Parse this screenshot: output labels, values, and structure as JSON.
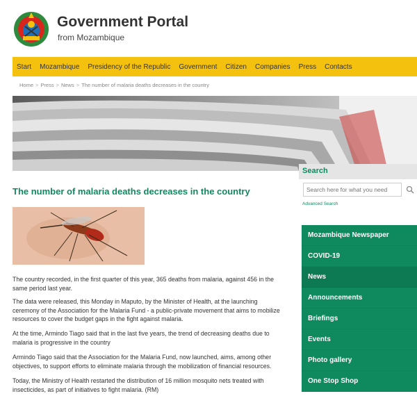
{
  "header": {
    "title": "Government Portal",
    "subtitle": "from Mozambique"
  },
  "nav": {
    "items": [
      {
        "label": "Start"
      },
      {
        "label": "Mozambique"
      },
      {
        "label": "Presidency of the Republic"
      },
      {
        "label": "Government"
      },
      {
        "label": "Citizen"
      },
      {
        "label": "Companies"
      },
      {
        "label": "Press"
      },
      {
        "label": "Contacts"
      }
    ]
  },
  "breadcrumb": {
    "items": [
      "Home",
      "Press",
      "News",
      "The number of malaria deaths decreases in the country"
    ],
    "separator": ">"
  },
  "article": {
    "title": "The number of malaria deaths decreases in the country",
    "paragraphs": [
      "The country recorded, in the first quarter of this year, 365 deaths from malaria, against 456 in the same period last year.",
      "The data were released, this Monday in Maputo, by the Minister of Health, at the launching ceremony of the Association for the Malaria Fund - a public-private movement that aims to mobilize resources to cover the budget gaps in the fight against malaria.",
      "At the time, Armindo Tiago said that in the last five years, the trend of decreasing deaths due to malaria is progressive in the country",
      "Armindo Tiago said that the Association for the Malaria Fund, now launched, aims, among other objectives, to support efforts to eliminate malaria through the mobilization of financial resources.",
      "Today, the Ministry of Health restarted the distribution of 16 million mosquito nets treated with insecticides, as part of initiatives to fight malaria. (RM)"
    ]
  },
  "sidebar": {
    "search_title": "Search",
    "search_placeholder": "Search here for what you need",
    "advanced_search": "Advanced Search",
    "menu": [
      {
        "label": "Mozambique Newspaper"
      },
      {
        "label": "COVID-19"
      },
      {
        "label": "News"
      },
      {
        "label": "Announcements"
      },
      {
        "label": "Briefings"
      },
      {
        "label": "Events"
      },
      {
        "label": "Photo gallery"
      },
      {
        "label": "One Stop Shop"
      }
    ],
    "active_item": "News"
  },
  "colors": {
    "accent_green": "#0f8a5f",
    "nav_yellow": "#f4c10f"
  }
}
